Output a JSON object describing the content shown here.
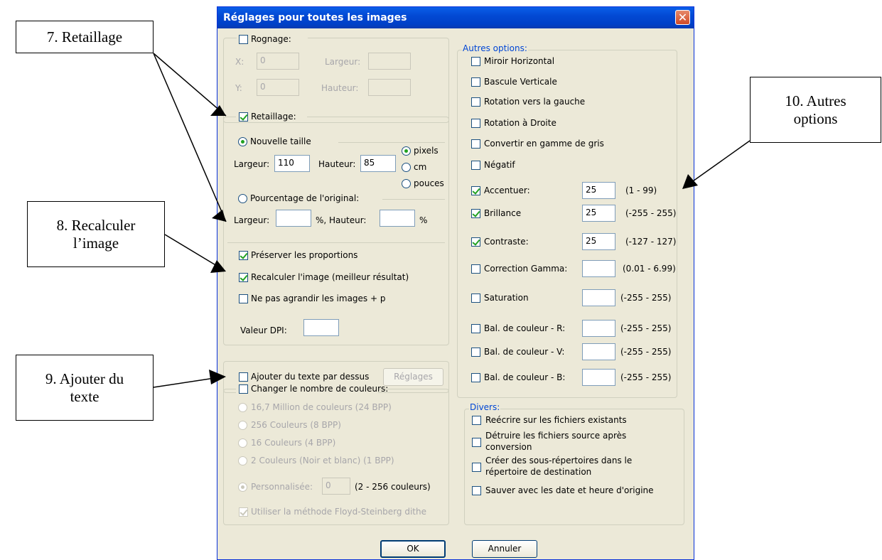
{
  "callouts": {
    "c7": "7. Retaillage",
    "c8_line1": "8. Recalculer",
    "c8_line2": "l’image",
    "c9_line1": "9. Ajouter du",
    "c9_line2": "texte",
    "c10_line1": "10. Autres",
    "c10_line2": "options"
  },
  "dialog": {
    "title": "Réglages pour toutes les images",
    "close_glyph": "✕",
    "rognage": {
      "label": "Rognage:",
      "x_label": "X:",
      "x_value": "0",
      "largeur_label": "Largeur:",
      "largeur_value": "",
      "y_label": "Y:",
      "y_value": "0",
      "hauteur_label": "Hauteur:",
      "hauteur_value": ""
    },
    "retaillage": {
      "label": "Retaillage:",
      "nouvelle_taille": "Nouvelle taille",
      "largeur_label": "Largeur:",
      "largeur_value": "110",
      "hauteur_label": "Hauteur:",
      "hauteur_value": "85",
      "unit_pixels": "pixels",
      "unit_cm": "cm",
      "unit_pouces": "pouces",
      "pourcentage": "Pourcentage de l'original:",
      "pct_largeur_label": "Largeur:",
      "pct_largeur_value": "",
      "pct_sep": "%,  Hauteur:",
      "pct_hauteur_value": "",
      "pct_unit": "%",
      "preserver": "Préserver les proportions",
      "recalculer": "Recalculer l'image (meilleur résultat)",
      "ne_pas_agrandir": "Ne pas agrandir les images + p",
      "dpi_label": "Valeur DPI:",
      "dpi_value": ""
    },
    "texte": {
      "label": "Ajouter du texte par dessus",
      "reglages": "Réglages"
    },
    "couleurs": {
      "label": "Changer le nombre de couleurs:",
      "opt1": "16,7 Million de couleurs (24 BPP)",
      "opt2": "256 Couleurs (8 BPP)",
      "opt3": "16 Couleurs (4 BPP)",
      "opt4": "2 Couleurs (Noir et blanc) (1 BPP)",
      "opt5": "Personnalisée:",
      "custom_value": "0",
      "custom_range": "(2 - 256 couleurs)",
      "floyd": "Utiliser la méthode Floyd-Steinberg dithe"
    },
    "autres": {
      "legend": "Autres options:",
      "miroir": "Miroir Horizontal",
      "bascule": "Bascule Verticale",
      "rot_gauche": "Rotation vers la gauche",
      "rot_droite": "Rotation à Droite",
      "gris": "Convertir en gamme de gris",
      "negatif": "Négatif",
      "accentuer": "Accentuer:",
      "accentuer_value": "25",
      "accentuer_range": "(1 - 99)",
      "brillance": "Brillance",
      "brillance_value": "25",
      "brillance_range": "(-255 - 255)",
      "contraste": "Contraste:",
      "contraste_value": "25",
      "contraste_range": "(-127 - 127)",
      "gamma": "Correction Gamma:",
      "gamma_value": "",
      "gamma_range": "(0.01 - 6.99)",
      "saturation": "Saturation",
      "saturation_value": "",
      "saturation_range": "(-255  -  255)",
      "bal_r": "Bal. de couleur - R:",
      "bal_r_value": "",
      "bal_r_range": "(-255  -  255)",
      "bal_v": "Bal. de couleur - V:",
      "bal_v_value": "",
      "bal_v_range": "(-255  -  255)",
      "bal_b": "Bal. de couleur - B:",
      "bal_b_value": "",
      "bal_b_range": "(-255  -  255)"
    },
    "divers": {
      "legend": "Divers:",
      "reecrire": "Reécrire sur les fichiers existants",
      "detruire_1": "Détruire les fichiers source après",
      "detruire_2": "conversion",
      "creer_1": "Créer des sous-répertoires dans le",
      "creer_2": "répertoire de destination",
      "sauver": "Sauver  avec les date et heure d'origine"
    },
    "ok": "OK",
    "annuler": "Annuler"
  }
}
